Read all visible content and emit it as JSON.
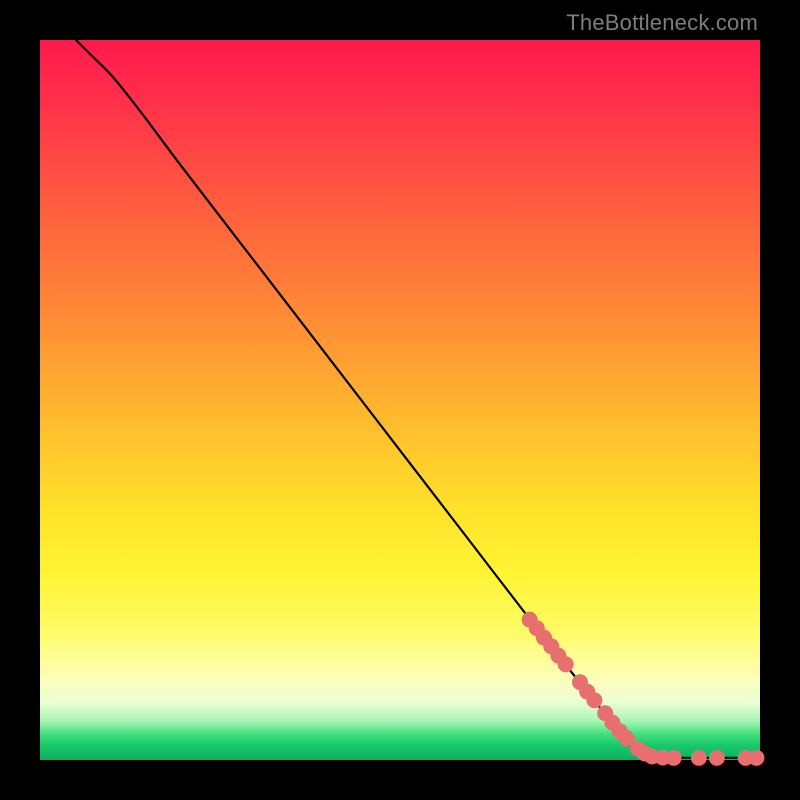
{
  "attribution": "TheBottleneck.com",
  "colors": {
    "dot": "#e76f6f",
    "curve": "#000000",
    "frame": "#000000"
  },
  "chart_data": {
    "type": "line",
    "title": "",
    "xlabel": "",
    "ylabel": "",
    "xlim": [
      0,
      100
    ],
    "ylim": [
      0,
      100
    ],
    "grid": false,
    "curve_points": [
      {
        "x": 5,
        "y": 100
      },
      {
        "x": 7,
        "y": 98
      },
      {
        "x": 10,
        "y": 95
      },
      {
        "x": 14,
        "y": 90
      },
      {
        "x": 20,
        "y": 82
      },
      {
        "x": 30,
        "y": 69
      },
      {
        "x": 40,
        "y": 56
      },
      {
        "x": 50,
        "y": 43
      },
      {
        "x": 60,
        "y": 30
      },
      {
        "x": 70,
        "y": 17
      },
      {
        "x": 78,
        "y": 7
      },
      {
        "x": 82,
        "y": 2
      },
      {
        "x": 85,
        "y": 0.5
      },
      {
        "x": 90,
        "y": 0.3
      },
      {
        "x": 95,
        "y": 0.3
      },
      {
        "x": 100,
        "y": 0.3
      }
    ],
    "markers": [
      {
        "x": 68,
        "y": 19.5
      },
      {
        "x": 69,
        "y": 18.3
      },
      {
        "x": 70,
        "y": 17.0
      },
      {
        "x": 71,
        "y": 15.8
      },
      {
        "x": 72,
        "y": 14.5
      },
      {
        "x": 73,
        "y": 13.3
      },
      {
        "x": 75,
        "y": 10.8
      },
      {
        "x": 76,
        "y": 9.5
      },
      {
        "x": 77,
        "y": 8.3
      },
      {
        "x": 78.5,
        "y": 6.5
      },
      {
        "x": 79.5,
        "y": 5.2
      },
      {
        "x": 80.5,
        "y": 4.0
      },
      {
        "x": 81.5,
        "y": 3.0
      },
      {
        "x": 83,
        "y": 1.6
      },
      {
        "x": 84,
        "y": 0.9
      },
      {
        "x": 85,
        "y": 0.5
      },
      {
        "x": 86.5,
        "y": 0.35
      },
      {
        "x": 88,
        "y": 0.3
      },
      {
        "x": 91.5,
        "y": 0.3
      },
      {
        "x": 94,
        "y": 0.3
      },
      {
        "x": 98,
        "y": 0.3
      },
      {
        "x": 99.5,
        "y": 0.3
      }
    ]
  }
}
